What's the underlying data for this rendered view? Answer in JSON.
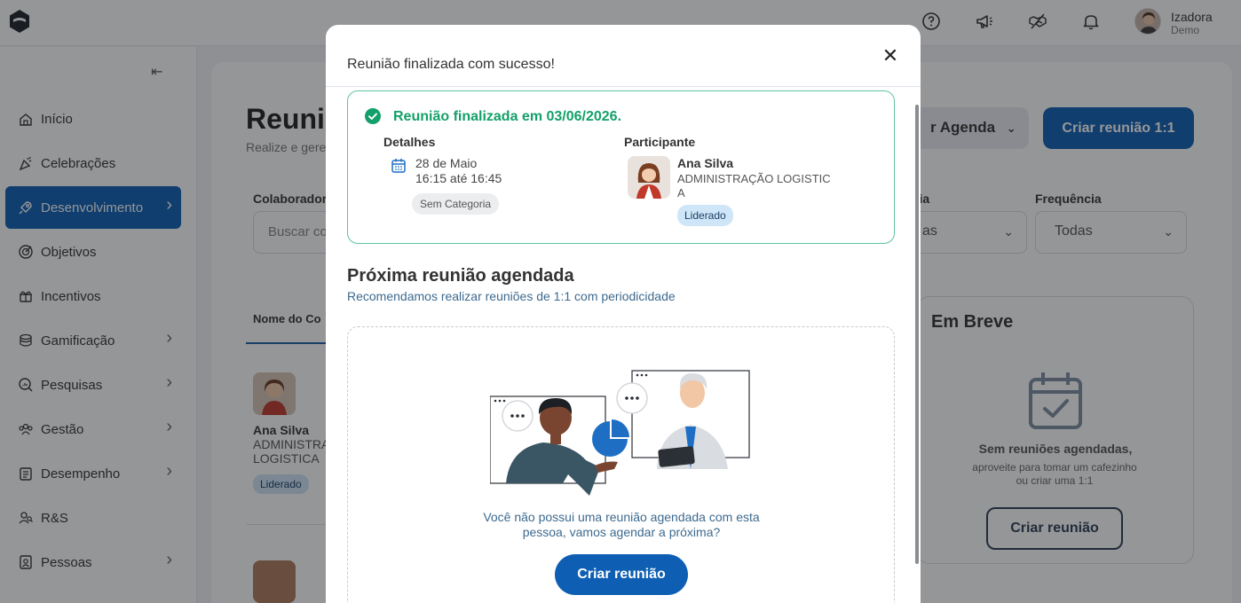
{
  "topbar": {
    "user_name": "Izadora",
    "user_role": "Demo"
  },
  "sidebar": {
    "items": [
      {
        "label": "Início",
        "icon": "home-icon",
        "has_children": false
      },
      {
        "label": "Celebrações",
        "icon": "celebration-icon",
        "has_children": false
      },
      {
        "label": "Desenvolvimento",
        "icon": "rocket-icon",
        "has_children": true,
        "active": true
      },
      {
        "label": "Objetivos",
        "icon": "target-icon",
        "has_children": false
      },
      {
        "label": "Incentivos",
        "icon": "gift-icon",
        "has_children": false
      },
      {
        "label": "Gamificação",
        "icon": "coins-icon",
        "has_children": true
      },
      {
        "label": "Pesquisas",
        "icon": "survey-icon",
        "has_children": true
      },
      {
        "label": "Gestão",
        "icon": "team-icon",
        "has_children": true
      },
      {
        "label": "Desempenho",
        "icon": "clipboard-icon",
        "has_children": true
      },
      {
        "label": "R&S",
        "icon": "recruit-icon",
        "has_children": false
      },
      {
        "label": "Pessoas",
        "icon": "people-icon",
        "has_children": true
      }
    ]
  },
  "page": {
    "title": "Reuni",
    "subtitle": "Realize e gere",
    "agenda_button": "r Agenda",
    "create_1on1_button": "Criar reunião 1:1",
    "filters": {
      "collaborator_label": "Colaborador",
      "collaborator_placeholder": "Buscar co",
      "category_label": "ria",
      "category_value": "as",
      "frequency_label": "Frequência",
      "frequency_value": "Todas"
    },
    "table": {
      "column_name_header": "Nome do Co",
      "row": {
        "name": "Ana Silva",
        "dept": "ADMINISTRA LOGISTICA",
        "badge": "Liderado"
      }
    },
    "coming_soon": {
      "title": "Em Breve",
      "strong": "Sem reuniões agendadas,",
      "text": "aproveite para tomar um cafezinho ou criar uma 1:1",
      "button": "Criar reunião"
    }
  },
  "modal": {
    "title": "Reunião finalizada com sucesso!",
    "success": {
      "title": "Reunião finalizada em 03/06/2026.",
      "details_label": "Detalhes",
      "date": "28 de Maio",
      "time": "16:15 até 16:45",
      "category": "Sem Categoria",
      "participant_label": "Participante",
      "participant_name": "Ana Silva",
      "participant_dept": "ADMINISTRAÇÃO LOGISTICA",
      "participant_badge": "Liderado"
    },
    "next": {
      "title": "Próxima reunião agendada",
      "subtitle": "Recomendamos realizar reuniões de 1:1 com periodicidade",
      "empty_text": "Você não possui uma reunião agendada com esta pessoa, vamos agendar a próxima?",
      "button": "Criar reunião"
    }
  },
  "colors": {
    "primary": "#0e5fb3",
    "success": "#14a06b",
    "success_border": "#5fc2a4",
    "badge_bg": "#cfe6f8"
  }
}
